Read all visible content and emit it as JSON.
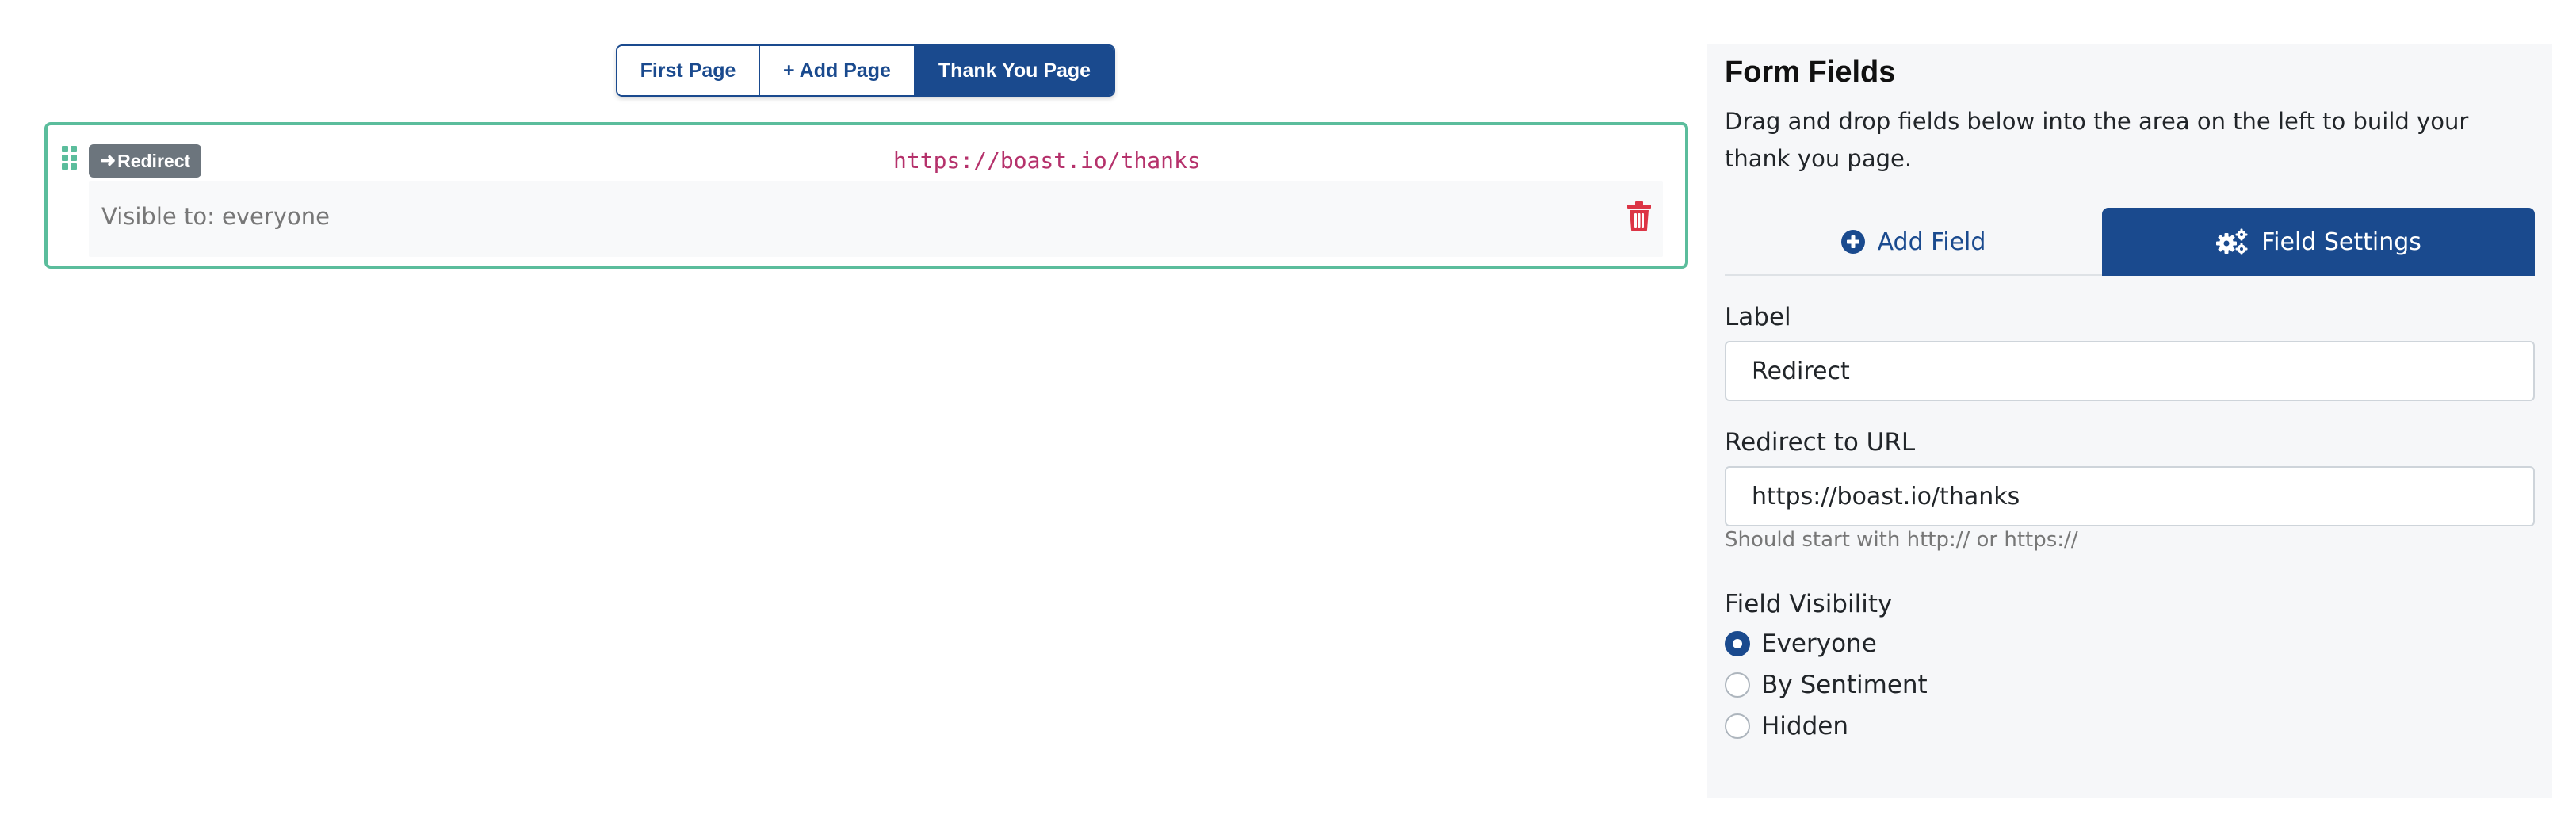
{
  "page_tabs": [
    {
      "label": "First Page",
      "active": false
    },
    {
      "label": "+ Add Page",
      "active": false
    },
    {
      "label": "Thank You Page",
      "active": true
    }
  ],
  "canvas": {
    "field": {
      "type_badge": "Redirect",
      "badge_icon": "arrow-right-icon",
      "url_preview": "https://boast.io/thanks",
      "visibility_text": "Visible to:  everyone",
      "delete_icon": "trash-icon"
    }
  },
  "sidebar": {
    "title": "Form Fields",
    "description": "Drag and drop fields below into the area on the left to build your thank you page.",
    "tabs": [
      {
        "label": "Add Field",
        "icon": "plus-circle-icon",
        "active": false
      },
      {
        "label": "Field Settings",
        "icon": "gears-icon",
        "active": true
      }
    ],
    "label_field": {
      "label": "Label",
      "value": "Redirect"
    },
    "url_field": {
      "label": "Redirect to URL",
      "value": "https://boast.io/thanks",
      "help": "Should start with http:// or https://"
    },
    "visibility": {
      "label": "Field Visibility",
      "options": [
        {
          "label": "Everyone",
          "checked": true
        },
        {
          "label": "By Sentiment",
          "checked": false
        },
        {
          "label": "Hidden",
          "checked": false
        }
      ]
    }
  },
  "colors": {
    "primary": "#1a4a8e",
    "card_border": "#5bbd9c",
    "url_text": "#b5316b",
    "danger": "#dc3545",
    "badge_bg": "#6c757d"
  }
}
